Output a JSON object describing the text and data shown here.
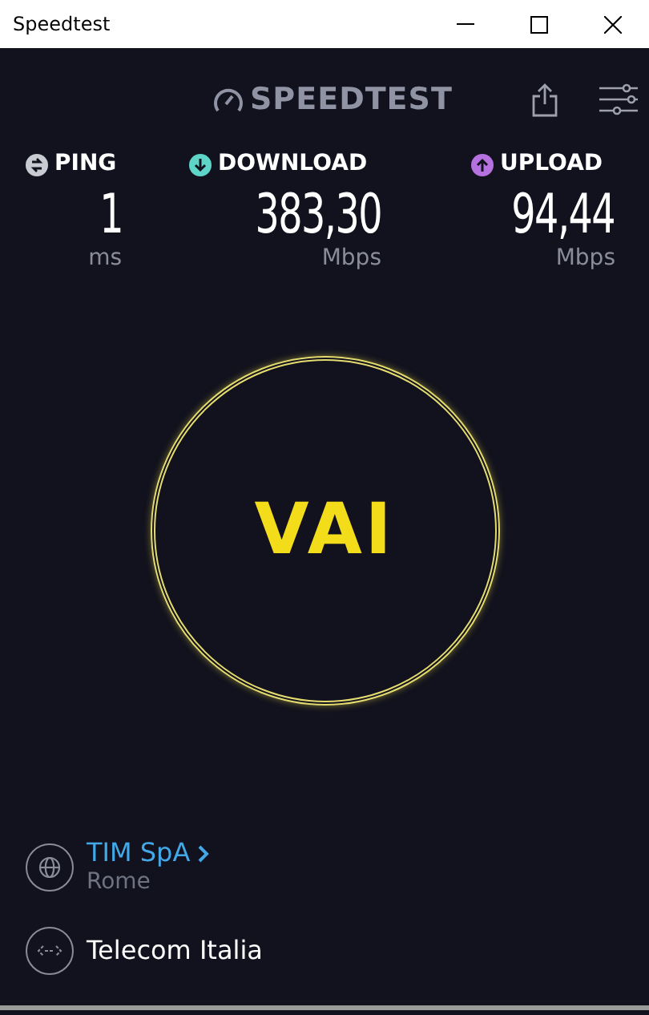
{
  "window": {
    "title": "Speedtest"
  },
  "logo": "SPEEDTEST",
  "metrics": [
    {
      "kind": "ping",
      "label": "PING",
      "value": "1",
      "unit": "ms"
    },
    {
      "kind": "download",
      "label": "DOWNLOAD",
      "value": "383,30",
      "unit": "Mbps"
    },
    {
      "kind": "upload",
      "label": "UPLOAD",
      "value": "94,44",
      "unit": "Mbps"
    }
  ],
  "go_button": "VAI",
  "server": {
    "name": "TIM SpA",
    "location": "Rome"
  },
  "provider": "Telecom Italia"
}
